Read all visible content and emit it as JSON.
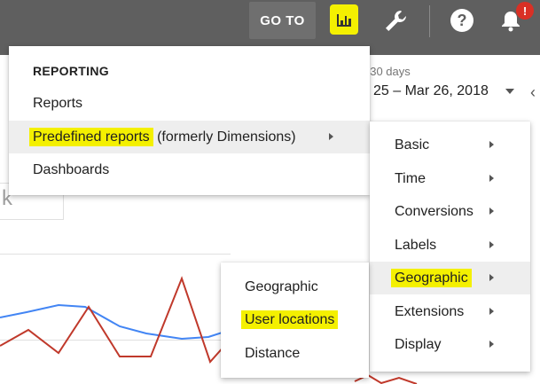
{
  "topbar": {
    "goto_label": "GO TO",
    "help_glyph": "?",
    "notification_badge": "!",
    "colors": {
      "bar": "#5f5f5f",
      "highlight": "#f4f000",
      "badge": "#d93025"
    }
  },
  "date_range": {
    "label": "t 30 days",
    "value": "25 – Mar 26, 2018"
  },
  "background": {
    "search_fragment": "k"
  },
  "reporting_menu": {
    "heading": "REPORTING",
    "items": [
      {
        "label": "Reports"
      },
      {
        "label": "Predefined reports",
        "suffix": "(formerly Dimensions)",
        "highlighted": true,
        "submenu": true
      },
      {
        "label": "Dashboards"
      }
    ]
  },
  "predefined_submenu": {
    "items": [
      {
        "label": "Basic",
        "submenu": true
      },
      {
        "label": "Time",
        "submenu": true
      },
      {
        "label": "Conversions",
        "submenu": true
      },
      {
        "label": "Labels",
        "submenu": true
      },
      {
        "label": "Geographic",
        "submenu": true,
        "highlighted": true
      },
      {
        "label": "Extensions",
        "submenu": true
      },
      {
        "label": "Display",
        "submenu": true
      }
    ]
  },
  "geographic_submenu": {
    "items": [
      {
        "label": "Geographic"
      },
      {
        "label": "User locations",
        "highlighted": true
      },
      {
        "label": "Distance"
      }
    ]
  },
  "chart_colors": {
    "series_a": "#4285f4",
    "series_b": "#c0392b"
  }
}
